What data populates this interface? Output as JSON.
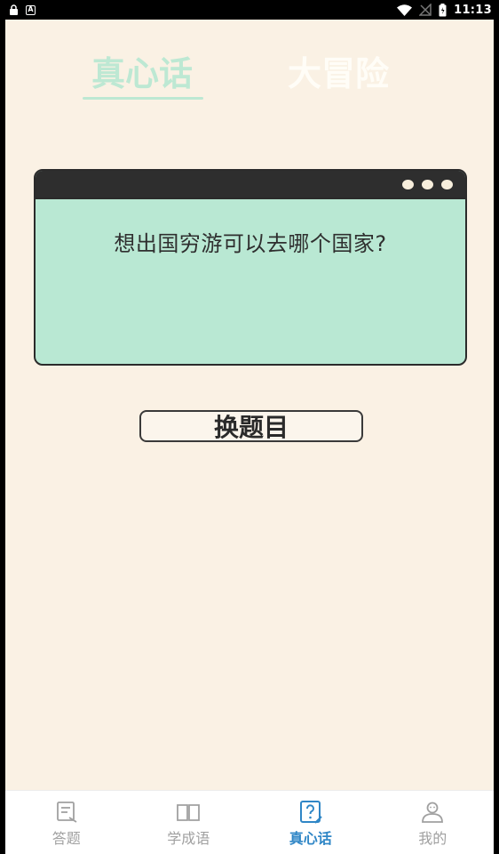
{
  "status_bar": {
    "time": "11:13",
    "left_icons": [
      "lock-icon",
      "a-icon"
    ],
    "right_icons": [
      "wifi-icon",
      "no-signal-icon",
      "battery-icon"
    ]
  },
  "tabs": [
    {
      "label": "真心话",
      "active": true
    },
    {
      "label": "大冒险",
      "active": false
    }
  ],
  "card": {
    "question": "想出国穷游可以去哪个国家?"
  },
  "change_button": {
    "label": "换题目"
  },
  "bottom_nav": {
    "items": [
      {
        "label": "答题",
        "icon": "quiz-icon",
        "active": false
      },
      {
        "label": "学成语",
        "icon": "book-icon",
        "active": false
      },
      {
        "label": "真心话",
        "icon": "question-icon",
        "active": true
      },
      {
        "label": "我的",
        "icon": "profile-icon",
        "active": false
      }
    ]
  },
  "colors": {
    "background": "#faf1e4",
    "accent_mint": "#b9e8d3",
    "card_header": "#2e2e2e",
    "nav_active": "#2f86c6",
    "nav_inactive": "#a0a0a0"
  }
}
